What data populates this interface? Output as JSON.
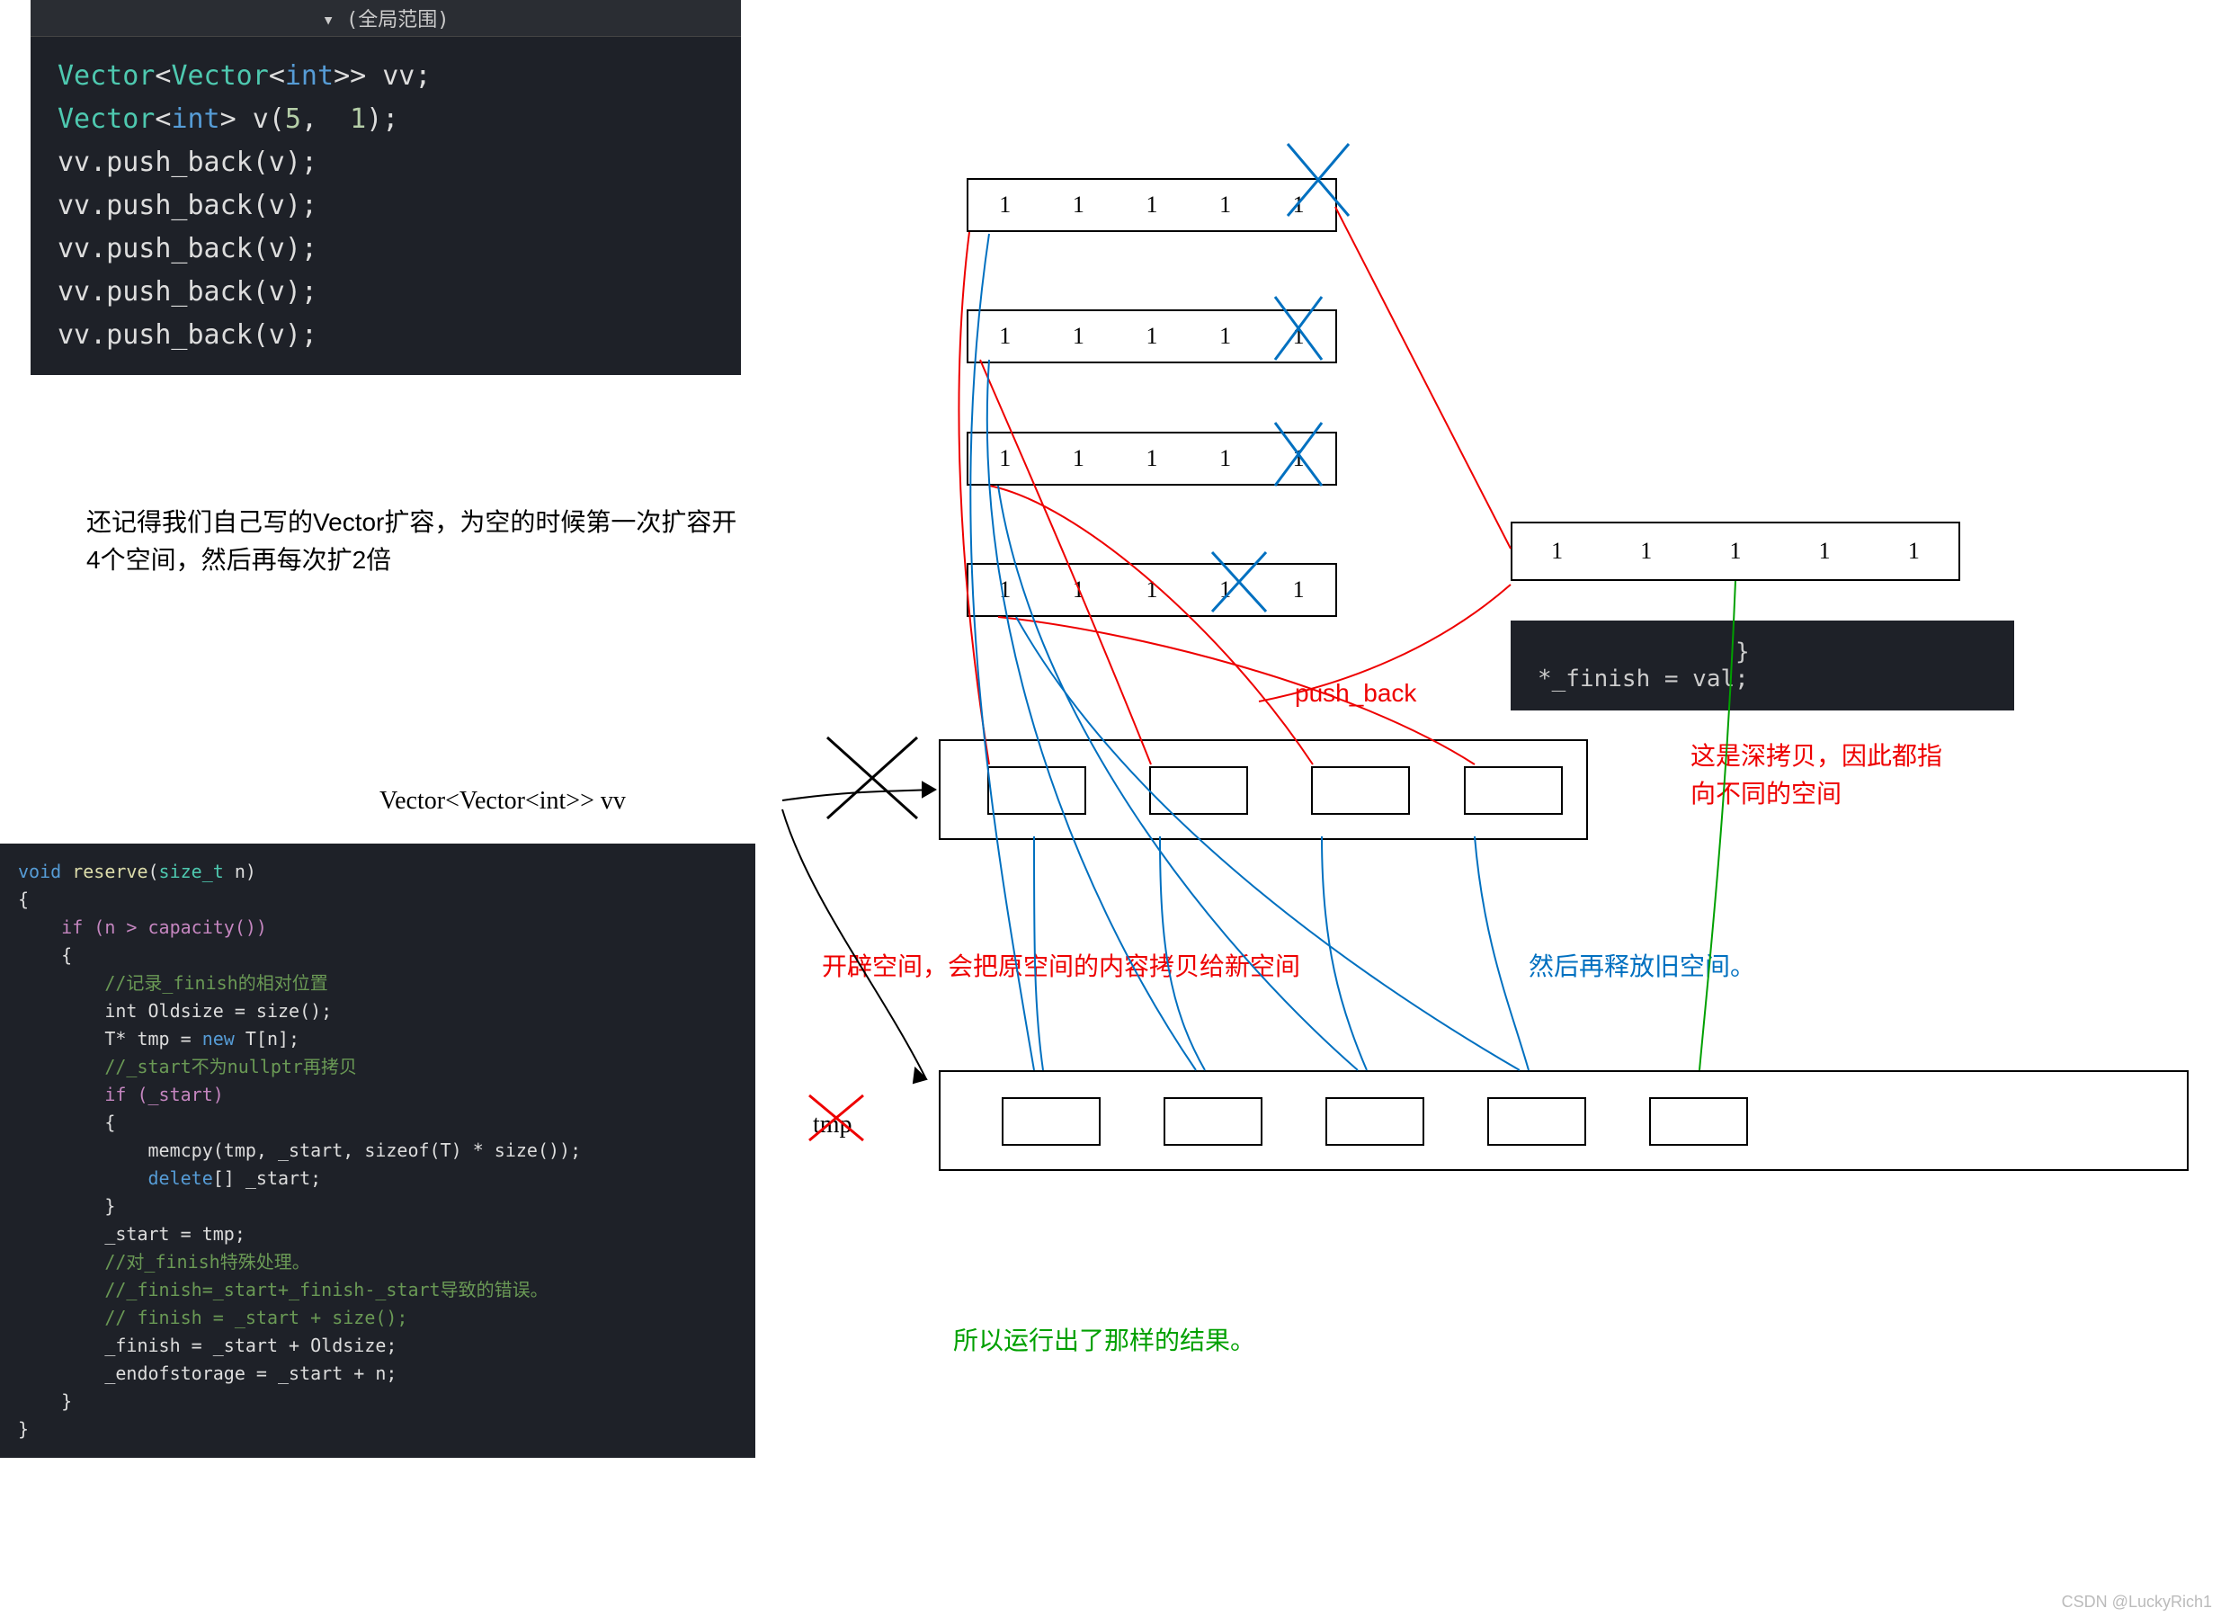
{
  "code1": {
    "header": "(全局范围)",
    "lines": {
      "l1a": "Vector",
      "l1b": "<",
      "l1c": "Vector",
      "l1d": "<",
      "l1e": "int",
      "l1f": ">> vv;",
      "l2a": "Vector",
      "l2b": "<",
      "l2c": "int",
      "l2d": "> v(",
      "l2e": "5",
      "l2f": ",  ",
      "l2g": "1",
      "l2h": ");",
      "l3": "vv.push_back(v);",
      "l4": "vv.push_back(v);",
      "l5": "vv.push_back(v);",
      "l6": "vv.push_back(v);",
      "l7": "vv.push_back(v);"
    }
  },
  "para1": "还记得我们自己写的Vector扩容，为空的时候第一次扩容开4个空间，然后再每次扩2倍",
  "code2": {
    "sig_a": "void",
    "sig_b": " reserve",
    "sig_c": "(",
    "sig_d": "size_t",
    "sig_e": " n)",
    "l_open": "{",
    "l_if": "    if (n > capacity())",
    "l_open2": "    {",
    "c1": "        //记录_finish的相对位置",
    "l_int": "        int Oldsize = size();",
    "l_tmp_a": "        T* tmp = ",
    "l_tmp_b": "new",
    "l_tmp_c": " T[n];",
    "c2": "        //_start不为nullptr再拷贝",
    "l_ifs": "        if (_start)",
    "l_open3": "        {",
    "l_mem": "            memcpy(tmp, _start, sizeof(T) * size());",
    "l_del_a": "            ",
    "l_del_b": "delete",
    "l_del_c": "[] _start;",
    "l_close3": "        }",
    "l_st": "        _start = tmp;",
    "c3": "        //对_finish特殊处理。",
    "c4": "        //_finish=_start+_finish-_start导致的错误。",
    "c5": "        // finish = _start + size();",
    "l_fin": "        _finish = _start + Oldsize;",
    "l_eos": "        _endofstorage = _start + n;",
    "l_close2": "    }",
    "l_close": "}"
  },
  "darkbox": {
    "brace": "}",
    "line": "*_finish = val;"
  },
  "labels": {
    "vv": "Vector<Vector<int>> vv",
    "tmp": "tmp",
    "pushback": "push_back",
    "deepcopy1": "这是深拷贝，因此都指",
    "deepcopy2": "向不同的空间",
    "copy_red": "开辟空间，会把原空间的内容拷贝给新空间",
    "release_blue": "然后再释放旧空间。",
    "result_green": "所以运行出了那样的结果。"
  },
  "vecrow": {
    "v1": "1",
    "v2": "1",
    "v3": "1",
    "v4": "1",
    "v5": "1"
  },
  "watermark": "CSDN @LuckyRich1"
}
